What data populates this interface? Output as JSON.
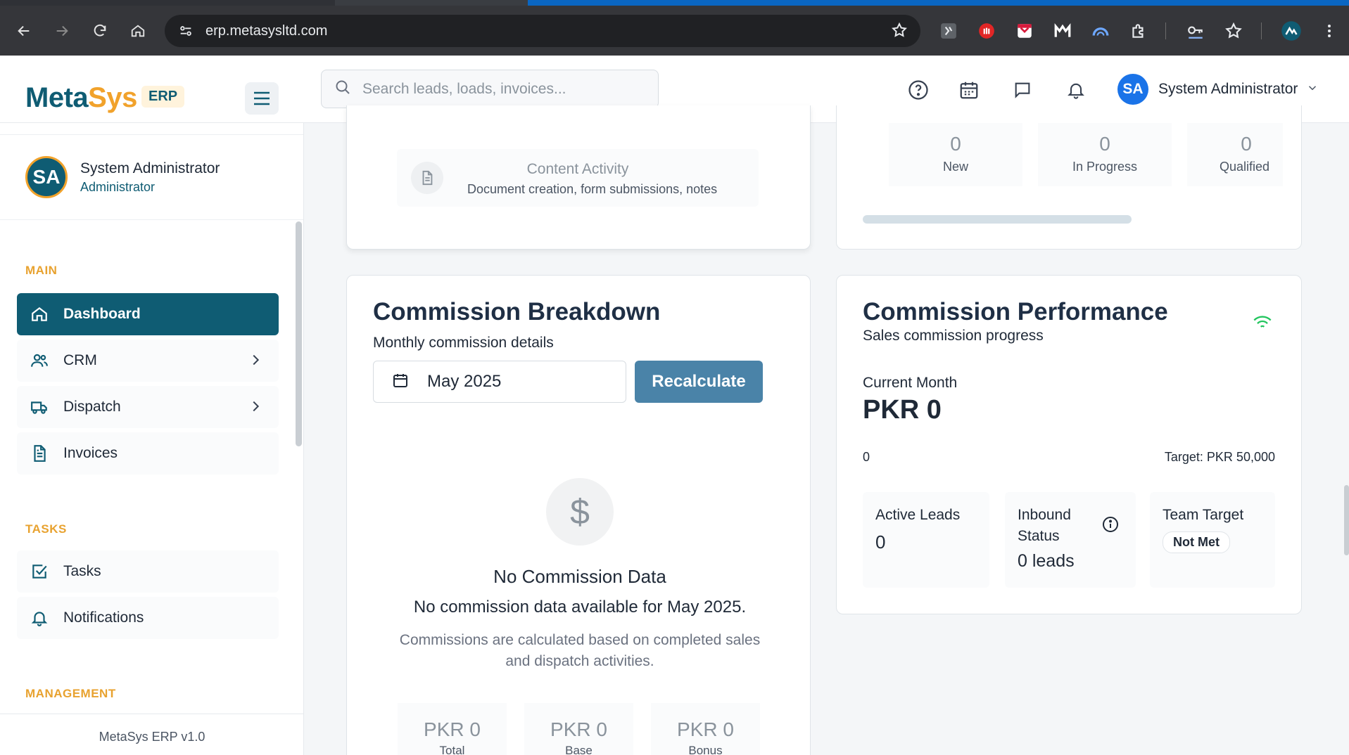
{
  "browser": {
    "url": "erp.metasysltd.com"
  },
  "app": {
    "logo_meta": "Meta",
    "logo_sys": "Sys",
    "logo_badge": "ERP",
    "search_placeholder": "Search leads, loads, invoices...",
    "user_name": "System Administrator",
    "user_initials": "SA"
  },
  "sidebar": {
    "profile_name": "System Administrator",
    "profile_role": "Administrator",
    "profile_initials": "SA",
    "section_main": "MAIN",
    "section_tasks": "TASKS",
    "section_management": "MANAGEMENT",
    "items": [
      {
        "label": "Dashboard",
        "icon": "home-icon",
        "active": true
      },
      {
        "label": "CRM",
        "icon": "users-icon",
        "has_children": true
      },
      {
        "label": "Dispatch",
        "icon": "truck-icon",
        "has_children": true
      },
      {
        "label": "Invoices",
        "icon": "file-text-icon"
      },
      {
        "label": "Tasks",
        "icon": "check-square-icon"
      },
      {
        "label": "Notifications",
        "icon": "bell-icon"
      }
    ],
    "footer": "MetaSys ERP v1.0"
  },
  "activity_card": {
    "content_title": "Content Activity",
    "content_sub": "Document creation, form submissions, notes"
  },
  "leads_card": {
    "stats": [
      {
        "value": "0",
        "label": "New"
      },
      {
        "value": "0",
        "label": "In Progress"
      },
      {
        "value": "0",
        "label": "Qualified"
      }
    ]
  },
  "commission_breakdown": {
    "title": "Commission Breakdown",
    "subtitle": "Monthly commission details",
    "month": "May 2025",
    "recalc_label": "Recalculate",
    "empty_icon": "$",
    "empty_title": "No Commission Data",
    "empty_msg": "No commission data available for May 2025.",
    "empty_note": "Commissions are calculated based on completed sales and dispatch activities.",
    "totals": [
      {
        "value": "PKR 0",
        "label": "Total"
      },
      {
        "value": "PKR 0",
        "label": "Base"
      },
      {
        "value": "PKR 0",
        "label": "Bonus"
      }
    ]
  },
  "commission_performance": {
    "title": "Commission Performance",
    "subtitle": "Sales commission progress",
    "current_label": "Current Month",
    "current_value": "PKR 0",
    "progress_value": "0",
    "target": "Target: PKR 50,000",
    "active_leads_label": "Active Leads",
    "active_leads_value": "0",
    "inbound_label_1": "Inbound",
    "inbound_label_2": "Status",
    "inbound_value": "0 leads",
    "team_target_label": "Team Target",
    "team_target_status": "Not Met"
  },
  "colors": {
    "brand_primary": "#0f5c73",
    "brand_accent": "#f1a22b",
    "button": "#4a83a8"
  }
}
